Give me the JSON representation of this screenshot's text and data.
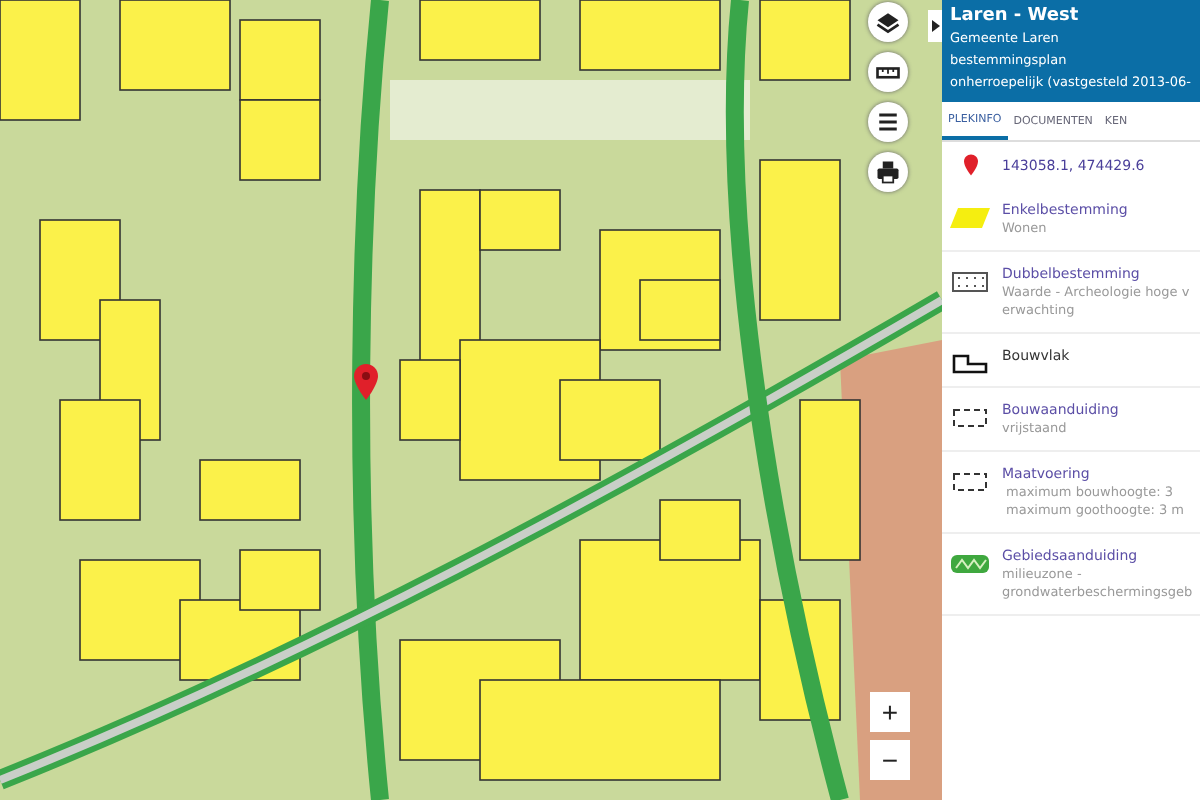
{
  "map": {
    "zoom_in": "+",
    "zoom_out": "−"
  },
  "panel": {
    "title": "Laren - West",
    "subtitle_lines": [
      "Gemeente Laren",
      "bestemmingsplan",
      "onherroepelijk (vastgesteld 2013-06-"
    ],
    "tabs": [
      {
        "label": "PLEKINFO",
        "selected": true
      },
      {
        "label": "DOCUMENTEN",
        "selected": false
      },
      {
        "label": "KEN",
        "selected": false
      }
    ],
    "items": [
      {
        "kind": "location",
        "title": "143058.1, 474429.6"
      },
      {
        "kind": "enkel",
        "title": "Enkelbestemming",
        "lines": [
          "Wonen"
        ]
      },
      {
        "kind": "dubbel",
        "title": "Dubbelbestemming",
        "lines": [
          "Waarde - Archeologie hoge verwachting"
        ]
      },
      {
        "kind": "bouwvlak",
        "title": "Bouwvlak"
      },
      {
        "kind": "aanduiding",
        "title": "Bouwaanduiding",
        "lines": [
          "vrijstaand"
        ]
      },
      {
        "kind": "maatvoering",
        "title": "Maatvoering",
        "bullets": [
          "maximum bouwhoogte: 3",
          "maximum goothoogte: 3 m"
        ]
      },
      {
        "kind": "gebied",
        "title": "Gebiedsaanduiding",
        "lines": [
          "milieuzone -",
          "grondwaterbeschermingsgeb"
        ]
      }
    ]
  }
}
